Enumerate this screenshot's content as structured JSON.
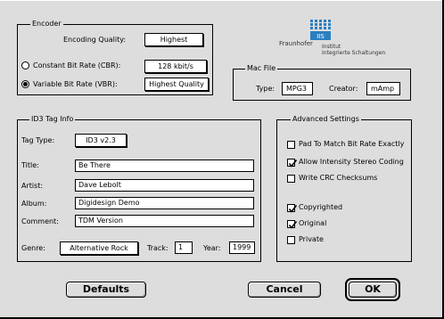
{
  "encoder": {
    "legend": "Encoder",
    "quality_label": "Encoding Quality:",
    "quality_value": "Highest",
    "cbr_label": "Constant Bit Rate (CBR):",
    "cbr_value": "128 kbit/s",
    "vbr_label": "Variable Bit Rate (VBR):",
    "vbr_value": "Highest Quality",
    "selected_mode": "vbr"
  },
  "logo": {
    "badge": "IIS",
    "brand": "Fraunhofer",
    "line1": "Institut",
    "line2": "Integrierte Schaltungen"
  },
  "macfile": {
    "legend": "Mac File",
    "type_label": "Type:",
    "type_value": "MPG3",
    "creator_label": "Creator:",
    "creator_value": "mAmp"
  },
  "id3": {
    "legend": "ID3 Tag Info",
    "tagtype_label": "Tag Type:",
    "tagtype_value": "ID3 v2.3",
    "title_label": "Title:",
    "title_value": "Be There",
    "artist_label": "Artist:",
    "artist_value": "Dave Lebolt",
    "album_label": "Album:",
    "album_value": "Digidesign Demo",
    "comment_label": "Comment:",
    "comment_value": "TDM Version",
    "genre_label": "Genre:",
    "genre_value": "Alternative Rock",
    "track_label": "Track:",
    "track_value": "1",
    "year_label": "Year:",
    "year_value": "1999"
  },
  "advanced": {
    "legend": "Advanced Settings",
    "options": [
      {
        "label": "Pad To Match Bit Rate Exactly",
        "checked": false
      },
      {
        "label": "Allow Intensity Stereo Coding",
        "checked": true
      },
      {
        "label": "Write CRC Checksums",
        "checked": false
      },
      {
        "label": "Copyrighted",
        "checked": true
      },
      {
        "label": "Original",
        "checked": true
      },
      {
        "label": "Private",
        "checked": false
      }
    ]
  },
  "buttons": {
    "defaults": "Defaults",
    "cancel": "Cancel",
    "ok": "OK"
  },
  "colors": {
    "window_bg": "#dddddd",
    "logo_blue": "#2a7fc0"
  }
}
